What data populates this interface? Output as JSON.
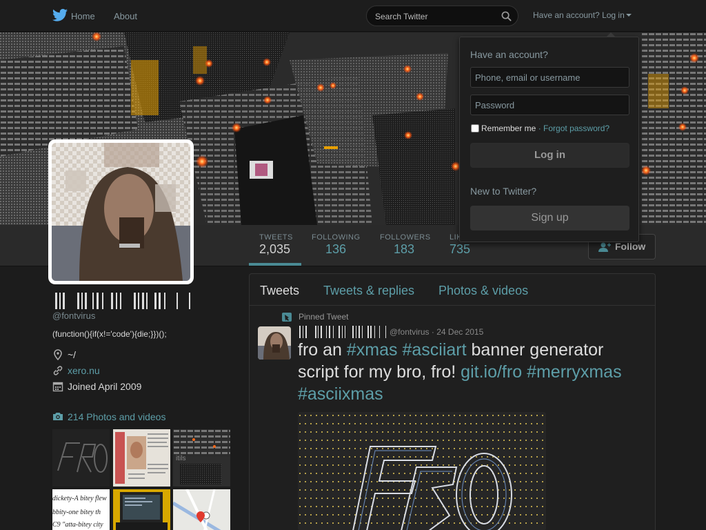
{
  "nav": {
    "home": "Home",
    "about": "About",
    "search_placeholder": "Search Twitter",
    "account_link": "Have an account? Log in"
  },
  "profile": {
    "handle": "@fontvirus",
    "bio": "(function(){if(x!='code'){die;}})();",
    "location": "~/",
    "website": "xero.nu",
    "joined": "Joined April 2009",
    "photos_label": "214 Photos and videos"
  },
  "stats": [
    {
      "label": "TWEETS",
      "value": "2,035"
    },
    {
      "label": "FOLLOWING",
      "value": "136"
    },
    {
      "label": "FOLLOWERS",
      "value": "183"
    },
    {
      "label": "LIKES",
      "value": "735"
    }
  ],
  "follow_label": "Follow",
  "timeline": {
    "tabs": [
      "Tweets",
      "Tweets & replies",
      "Photos & videos"
    ],
    "pinned_label": "Pinned Tweet",
    "tweet": {
      "handle": "@fontvirus",
      "date": "24 Dec 2015",
      "t1": "fro an ",
      "h1": "#xmas",
      "t2": " ",
      "h2": "#asciiart",
      "t3": "  banner generator script for my bro, fro! ",
      "h3": "git.io/fro",
      "t4": " ",
      "h4": "#merryxmas",
      "t5": " ",
      "h5": "#asciixmas"
    }
  },
  "login": {
    "title": "Have an account?",
    "username_placeholder": "Phone, email or username",
    "password_placeholder": "Password",
    "remember": "Remember me",
    "separator": "·",
    "forgot": "Forgot password?",
    "login_button": "Log in",
    "new_label": "New to Twitter?",
    "signup_button": "Sign up"
  },
  "thumbs": {
    "t4_lines": [
      "dickety-A bitey flew",
      "bbity-one bitey th",
      "C9 \"atta-bitey city"
    ]
  },
  "colors": {
    "accent": "#5d9ea8",
    "background": "#1c1c1c",
    "twitter_blue": "#55acee"
  },
  "icons": [
    "twitter-bird-icon",
    "home-icon",
    "about-icon",
    "search-icon",
    "location-icon",
    "link-icon",
    "calendar-icon",
    "camera-icon",
    "pin-icon",
    "follow-icon"
  ]
}
